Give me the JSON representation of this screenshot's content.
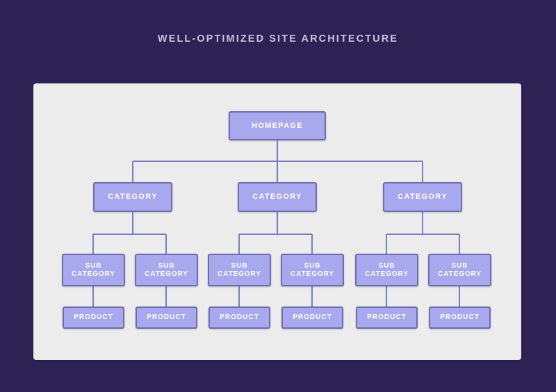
{
  "page": {
    "title": "WELL-OPTIMIZED SITE ARCHITECTURE",
    "background_color": "#2d2254",
    "title_color": "#c9c4e0",
    "card_color": "#ececec",
    "node_fill": "#a8a8ef",
    "node_border": "#6d6dab",
    "node_text_color": "#ffffff",
    "connector_color": "#7b7bc0"
  },
  "diagram": {
    "type": "tree",
    "orientation": "top-down",
    "levels": [
      "homepage",
      "category",
      "subcategory",
      "product"
    ],
    "nodes": {
      "homepage": {
        "label": "HOMEPAGE"
      },
      "categories": [
        {
          "label": "CATEGORY"
        },
        {
          "label": "CATEGORY"
        },
        {
          "label": "CATEGORY"
        }
      ],
      "subcategories": [
        {
          "line1": "SUB",
          "line2": "CATEGORY"
        },
        {
          "line1": "SUB",
          "line2": "CATEGORY"
        },
        {
          "line1": "SUB",
          "line2": "CATEGORY"
        },
        {
          "line1": "SUB",
          "line2": "CATEGORY"
        },
        {
          "line1": "SUB",
          "line2": "CATEGORY"
        },
        {
          "line1": "SUB",
          "line2": "CATEGORY"
        }
      ],
      "products": [
        {
          "label": "PRODUCT"
        },
        {
          "label": "PRODUCT"
        },
        {
          "label": "PRODUCT"
        },
        {
          "label": "PRODUCT"
        },
        {
          "label": "PRODUCT"
        },
        {
          "label": "PRODUCT"
        }
      ]
    }
  }
}
